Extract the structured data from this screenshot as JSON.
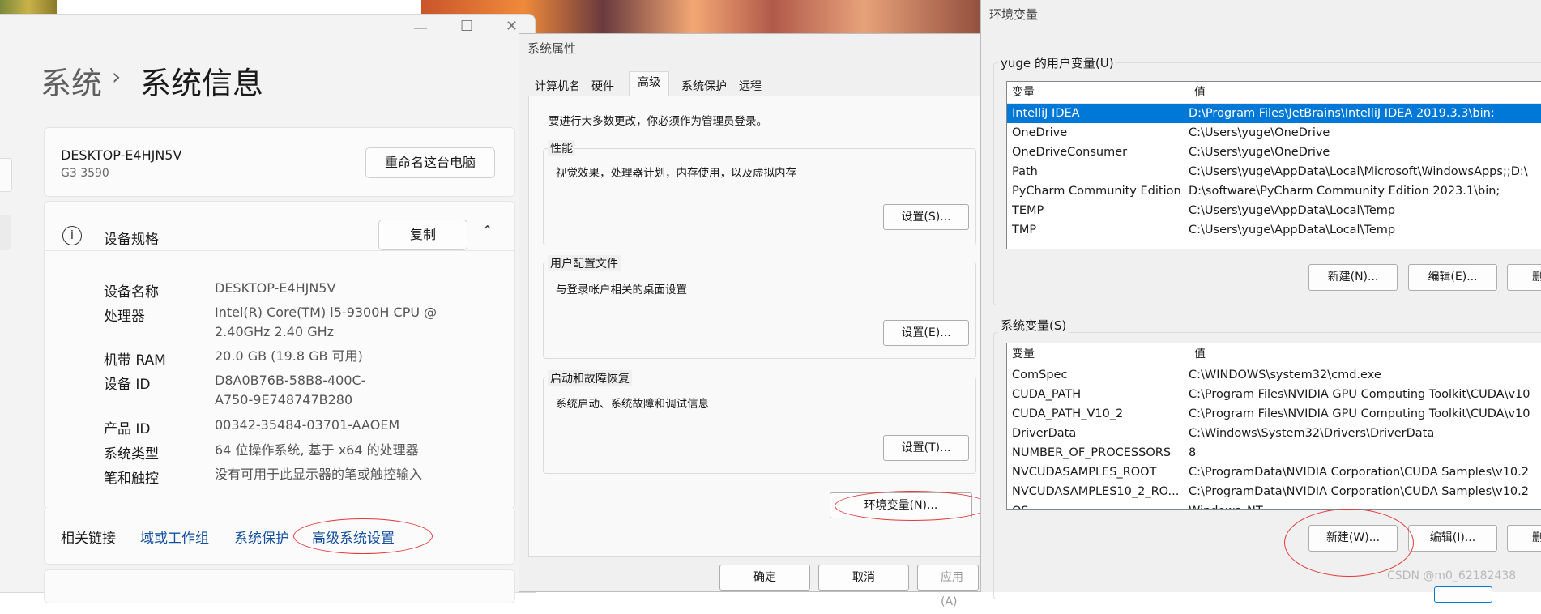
{
  "settings": {
    "breadcrumb_parent": "系统",
    "breadcrumb_sep": "›",
    "page_title": "系统信息",
    "device_name": "DESKTOP-E4HJN5V",
    "device_model": "G3 3590",
    "rename_button": "重命名这台电脑",
    "specs_title": "设备规格",
    "copy_button": "复制",
    "specs": [
      {
        "label": "设备名称",
        "value": "DESKTOP-E4HJN5V"
      },
      {
        "label": "处理器",
        "value": "Intel(R) Core(TM) i5-9300H CPU @",
        "value2": "2.40GHz   2.40 GHz"
      },
      {
        "label": "机带 RAM",
        "value": "20.0 GB (19.8 GB 可用)"
      },
      {
        "label": "设备 ID",
        "value": "D8A0B76B-58B8-400C-",
        "value2": "A750-9E748747B280"
      },
      {
        "label": "产品 ID",
        "value": "00342-35484-03701-AAOEM"
      },
      {
        "label": "系统类型",
        "value": "64 位操作系统, 基于 x64 的处理器"
      },
      {
        "label": "笔和触控",
        "value": "没有可用于此显示器的笔或触控输入"
      }
    ],
    "related_links_label": "相关链接",
    "links": [
      "域或工作组",
      "系统保护",
      "高级系统设置"
    ]
  },
  "sysprop": {
    "title": "系统属性",
    "tabs": [
      "计算机名",
      "硬件",
      "高级",
      "系统保护",
      "远程"
    ],
    "active_tab": "高级",
    "admin_note": "要进行大多数更改，你必须作为管理员登录。",
    "performance": {
      "label": "性能",
      "desc": "视觉效果，处理器计划，内存使用，以及虚拟内存",
      "button": "设置(S)..."
    },
    "user_profiles": {
      "label": "用户配置文件",
      "desc": "与登录帐户相关的桌面设置",
      "button": "设置(E)..."
    },
    "startup": {
      "label": "启动和故障恢复",
      "desc": "系统启动、系统故障和调试信息",
      "button": "设置(T)..."
    },
    "env_button": "环境变量(N)...",
    "ok_button": "确定",
    "cancel_button": "取消",
    "apply_button": "应用(A)"
  },
  "envvars": {
    "title": "环境变量",
    "user_group_label": "yuge 的用户变量(U)",
    "col_var": "变量",
    "col_val": "值",
    "user_rows": [
      {
        "name": "IntelliJ IDEA",
        "value": "D:\\Program Files\\JetBrains\\IntelliJ IDEA 2019.3.3\\bin;"
      },
      {
        "name": "OneDrive",
        "value": "C:\\Users\\yuge\\OneDrive"
      },
      {
        "name": "OneDriveConsumer",
        "value": "C:\\Users\\yuge\\OneDrive"
      },
      {
        "name": "Path",
        "value": "C:\\Users\\yuge\\AppData\\Local\\Microsoft\\WindowsApps;;D:\\"
      },
      {
        "name": "PyCharm Community Edition",
        "value": "D:\\software\\PyCharm Community Edition 2023.1\\bin;"
      },
      {
        "name": "TEMP",
        "value": "C:\\Users\\yuge\\AppData\\Local\\Temp"
      },
      {
        "name": "TMP",
        "value": "C:\\Users\\yuge\\AppData\\Local\\Temp"
      }
    ],
    "user_new": "新建(N)...",
    "user_edit": "编辑(E)...",
    "user_delete": "删",
    "system_group_label": "系统变量(S)",
    "system_rows": [
      {
        "name": "ComSpec",
        "value": "C:\\WINDOWS\\system32\\cmd.exe"
      },
      {
        "name": "CUDA_PATH",
        "value": "C:\\Program Files\\NVIDIA GPU Computing Toolkit\\CUDA\\v10"
      },
      {
        "name": "CUDA_PATH_V10_2",
        "value": "C:\\Program Files\\NVIDIA GPU Computing Toolkit\\CUDA\\v10"
      },
      {
        "name": "DriverData",
        "value": "C:\\Windows\\System32\\Drivers\\DriverData"
      },
      {
        "name": "NUMBER_OF_PROCESSORS",
        "value": "8"
      },
      {
        "name": "NVCUDASAMPLES_ROOT",
        "value": "C:\\ProgramData\\NVIDIA Corporation\\CUDA Samples\\v10.2"
      },
      {
        "name": "NVCUDASAMPLES10_2_RO...",
        "value": "C:\\ProgramData\\NVIDIA Corporation\\CUDA Samples\\v10.2"
      },
      {
        "name": "OS",
        "value": "Windows_NT"
      }
    ],
    "sys_new": "新建(W)...",
    "sys_edit": "编辑(I)...",
    "sys_delete": "删"
  },
  "watermark": "CSDN @m0_62182438",
  "colors": {
    "selection": "#0078d7",
    "annotation": "#e5393a",
    "link": "#1450a0"
  }
}
